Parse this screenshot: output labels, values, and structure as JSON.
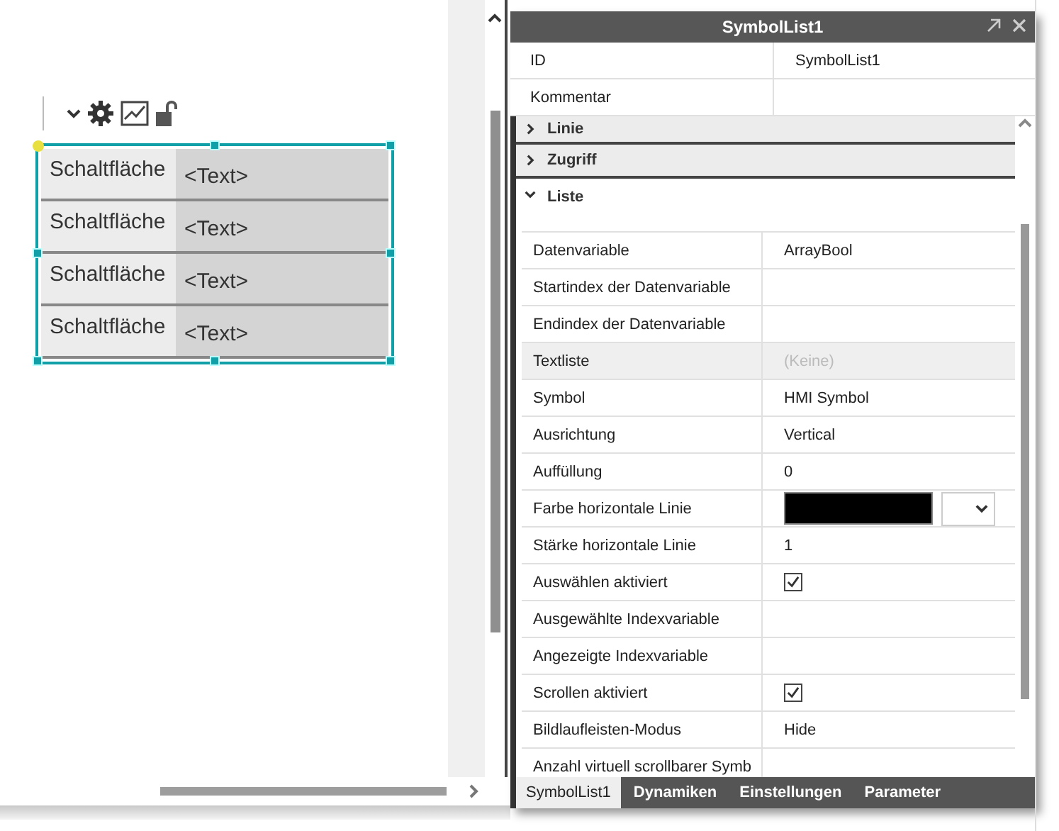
{
  "canvas": {
    "symbol_list": {
      "selected": true,
      "rows": [
        {
          "button": "Schaltfläche",
          "text": "<Text>"
        },
        {
          "button": "Schaltfläche",
          "text": "<Text>"
        },
        {
          "button": "Schaltfläche",
          "text": "<Text>"
        },
        {
          "button": "Schaltfläche",
          "text": "<Text>"
        }
      ]
    }
  },
  "properties": {
    "title": "SymbolList1",
    "header_rows": [
      {
        "label": "ID",
        "value": "SymbolList1"
      },
      {
        "label": "Kommentar"
      }
    ],
    "sections": [
      {
        "label": "Linie",
        "expanded": false
      },
      {
        "label": "Zugriff",
        "expanded": false
      },
      {
        "label": "Liste",
        "expanded": true
      }
    ],
    "rows": [
      {
        "kind": "text",
        "label": "Datenvariable",
        "value": "ArrayBool"
      },
      {
        "kind": "text",
        "label": "Startindex der Datenvariable"
      },
      {
        "kind": "text",
        "label": "Endindex der Datenvariable"
      },
      {
        "kind": "disabled",
        "label": "Textliste",
        "value": "(Keine)"
      },
      {
        "kind": "text",
        "label": "Symbol",
        "value": "HMI Symbol"
      },
      {
        "kind": "text",
        "label": "Ausrichtung",
        "value": "Vertical"
      },
      {
        "kind": "text",
        "label": "Auffüllung",
        "value": "0"
      },
      {
        "kind": "color",
        "label": "Farbe horizontale Linie",
        "color": "#000000"
      },
      {
        "kind": "text",
        "label": "Stärke horizontale Linie",
        "value": "1"
      },
      {
        "kind": "checkbox",
        "label": "Auswählen aktiviert",
        "checked": true
      },
      {
        "kind": "text",
        "label": "Ausgewählte Indexvariable"
      },
      {
        "kind": "text",
        "label": "Angezeigte Indexvariable"
      },
      {
        "kind": "checkbox",
        "label": "Scrollen aktiviert",
        "checked": true
      },
      {
        "kind": "text",
        "label": "Bildlaufleisten-Modus",
        "value": "Hide"
      },
      {
        "kind": "text",
        "label": "Anzahl virtuell scrollbarer Symb"
      }
    ],
    "tabs": [
      {
        "label": "SymbolList1",
        "selected": true
      },
      {
        "label": "Dynamiken",
        "selected": false
      },
      {
        "label": "Einstellungen",
        "selected": false
      },
      {
        "label": "Parameter",
        "selected": false
      }
    ]
  }
}
